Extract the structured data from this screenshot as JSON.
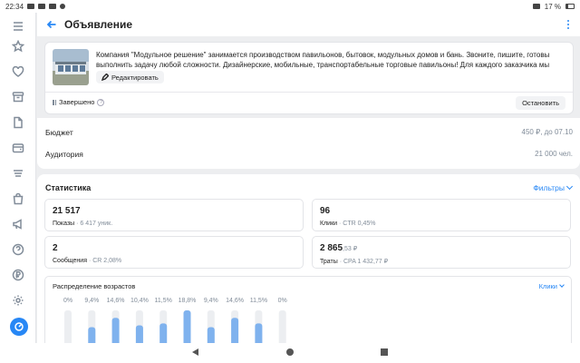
{
  "statusbar": {
    "time": "22:34",
    "battery": "17 %"
  },
  "header": {
    "title": "Объявление"
  },
  "ad": {
    "text": "Компания \"Модульное решение\" занимается производством павильонов, бытовок, модульных домов и бань. Звоните, пишите, готовы выполнить задачу любой сложности.  Дизайнерские, мобильные, транспортабельные торговые павильоны! Для каждого заказчика мы разрабатываем...",
    "edit_label": "Редактировать",
    "status": "Завершено",
    "stop_label": "Остановить"
  },
  "budget": {
    "label": "Бюджет",
    "value": "450 ₽, до 07.10"
  },
  "audience": {
    "label": "Аудитория",
    "value": "21 000 чел."
  },
  "stats": {
    "title": "Статистика",
    "filters_label": "Фильтры",
    "metrics": [
      {
        "value": "21 517",
        "value_frac": "",
        "label": "Показы",
        "extra": "· 6 417 уник."
      },
      {
        "value": "96",
        "value_frac": "",
        "label": "Клики",
        "extra": "· CTR 0,45%"
      },
      {
        "value": "2",
        "value_frac": "",
        "label": "Сообщения",
        "extra": "· CR 2,08%"
      },
      {
        "value": "2 865",
        "value_frac": ",53 ₽",
        "label": "Траты",
        "extra": "· CPA 1 432,77 ₽"
      }
    ]
  },
  "age": {
    "title": "Распределение возрастов",
    "selector": "Клики"
  },
  "chart_data": {
    "type": "bar",
    "title": "Распределение возрастов",
    "categories": [
      "",
      "",
      "",
      "",
      "",
      "",
      "",
      "",
      "",
      ""
    ],
    "values": [
      0,
      9.4,
      14.6,
      10.4,
      11.5,
      18.8,
      9.4,
      14.6,
      11.5,
      0
    ],
    "value_labels": [
      "0%",
      "9,4%",
      "14,6%",
      "10,4%",
      "11,5%",
      "18,8%",
      "9,4%",
      "14,6%",
      "11,5%",
      "0%"
    ],
    "ylim": [
      0,
      18.8
    ],
    "colors": {
      "bar": "#7fb2ee",
      "track": "#eceef1",
      "label": "#818c99"
    }
  }
}
